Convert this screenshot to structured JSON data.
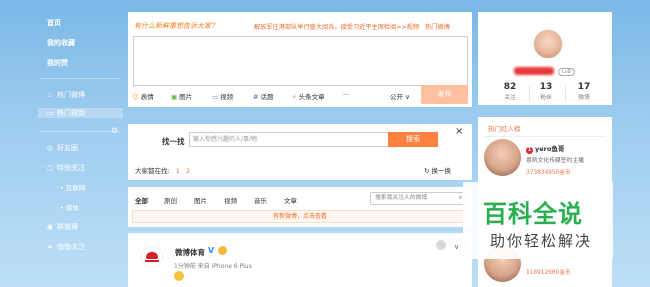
{
  "nav": {
    "home": "首页",
    "favorites": "我的收藏",
    "likes": "我的赞",
    "hot_weibo": "热门微博",
    "hot_video": "热门视频",
    "friends": "好友圈",
    "special": "特别关注",
    "internet": "互联网",
    "media": "媒体",
    "group": "群微博",
    "close_friends": "悄悄关注"
  },
  "publisher": {
    "prompt": "有什么新鲜事想告诉大家？",
    "hot_topic": "解放军往港部队举行盛大阅兵，接受习近平主席检阅>>视频",
    "hot_link": "热门微博",
    "tools": [
      "表情",
      "图片",
      "视频",
      "话题",
      "头条文章",
      "···"
    ],
    "visibility": "公开",
    "send": "发布"
  },
  "find": {
    "label": "找一找",
    "placeholder": "输入你感兴趣的人/事/物",
    "button": "搜索",
    "close": "×",
    "also": "大家都在找:",
    "page1": "1",
    "page2": "2",
    "swap": "换一换"
  },
  "feed": {
    "tabs": [
      "全部",
      "原创",
      "图片",
      "视频",
      "音乐",
      "文章"
    ],
    "search_placeholder": "搜索我关注人的微博",
    "new_posts": "有新微博，点击查看"
  },
  "post": {
    "author": "微博体育",
    "meta": "1分钟前 来自 iPhone 6 Plus"
  },
  "profile": {
    "level": "Lv8",
    "follow_count": "82",
    "follow_label": "关注",
    "fans_count": "13",
    "fans_label": "粉丝",
    "weibo_count": "17",
    "weibo_label": "微博"
  },
  "hot_people": {
    "title": "热门红人榜",
    "person": {
      "name": "yero鱼哥",
      "desc": "恩凯文化传媒签约主播",
      "stat": "373834950金币"
    },
    "person2_stat": "118912660金币"
  },
  "watermark": {
    "title": "百科全说",
    "subtitle": "助你轻松解决"
  },
  "colors": {
    "accent": "#ff8140",
    "link": "#eb7350",
    "background": "#9fcdf0"
  }
}
